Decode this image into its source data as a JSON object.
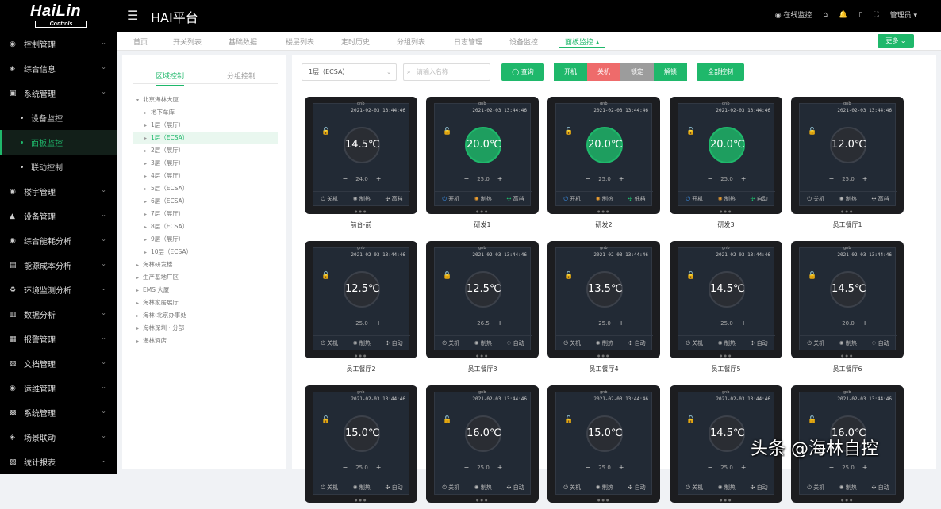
{
  "header": {
    "logo_word": "HaiLin",
    "logo_sub": "Controls",
    "menu_toggle": "☰",
    "title": "HAI平台",
    "right_items": [
      "◉ 在线监控",
      "⌂",
      "🔔",
      "▯",
      "⛶",
      "管理员 ▾"
    ]
  },
  "sidebar": {
    "items": [
      {
        "icon": "◉",
        "label": "控制管理"
      },
      {
        "icon": "◈",
        "label": "综合信息"
      },
      {
        "icon": "▣",
        "label": "系统管理"
      },
      {
        "icon": "◉",
        "label": "楼宇管理"
      },
      {
        "icon": "▲",
        "label": "设备管理"
      },
      {
        "icon": "◉",
        "label": "综合能耗分析"
      },
      {
        "icon": "▤",
        "label": "能源成本分析"
      },
      {
        "icon": "♻",
        "label": "环境监测分析"
      },
      {
        "icon": "▥",
        "label": "数据分析"
      },
      {
        "icon": "▦",
        "label": "报警管理"
      },
      {
        "icon": "▧",
        "label": "文档管理"
      },
      {
        "icon": "◉",
        "label": "运维管理"
      },
      {
        "icon": "▩",
        "label": "系统管理"
      },
      {
        "icon": "◈",
        "label": "场景联动"
      },
      {
        "icon": "▨",
        "label": "统计报表"
      }
    ],
    "subitems": [
      {
        "label": "设备监控"
      },
      {
        "label": "面板监控"
      },
      {
        "label": "联动控制"
      }
    ]
  },
  "tabs": [
    {
      "label": "首页"
    },
    {
      "label": "开关列表"
    },
    {
      "label": "基础数据"
    },
    {
      "label": "楼层列表"
    },
    {
      "label": "定时历史"
    },
    {
      "label": "分组列表"
    },
    {
      "label": "日志管理"
    },
    {
      "label": "设备监控"
    },
    {
      "label": "面板监控 ▴"
    }
  ],
  "back_button": "更多 ⌄",
  "tree": {
    "tabs": [
      "区域控制",
      "分组控制"
    ],
    "nodes": [
      {
        "label": "北京海林大厦",
        "level": 0,
        "open": true
      },
      {
        "label": "地下车库",
        "level": 1
      },
      {
        "label": "1层（展厅）",
        "level": 1
      },
      {
        "label": "1层（ECSA）",
        "level": 1,
        "selected": true
      },
      {
        "label": "2层（展厅）",
        "level": 1
      },
      {
        "label": "3层（展厅）",
        "level": 1
      },
      {
        "label": "4层（展厅）",
        "level": 1
      },
      {
        "label": "5层（ECSA）",
        "level": 1
      },
      {
        "label": "6层（ECSA）",
        "level": 1
      },
      {
        "label": "7层（展厅）",
        "level": 1
      },
      {
        "label": "8层（ECSA）",
        "level": 1
      },
      {
        "label": "9层（展厅）",
        "level": 1
      },
      {
        "label": "10层（ECSA）",
        "level": 1
      },
      {
        "label": "海林研发楼",
        "level": 0
      },
      {
        "label": "生产基地厂区",
        "level": 0
      },
      {
        "label": "EMS 大厦",
        "level": 0
      },
      {
        "label": "海林家居展厅",
        "level": 0
      },
      {
        "label": "海林·北京办事处",
        "level": 0
      },
      {
        "label": "海林深圳 · 分部",
        "level": 0
      },
      {
        "label": "海林酒店",
        "level": 0
      }
    ]
  },
  "toolbar": {
    "select_value": "1层（ECSA）",
    "search_placeholder": "请输入名称",
    "query": "◯ 查询",
    "on": "开机",
    "off": "关机",
    "lock": "锁定",
    "unlock": "解锁",
    "all": "全部控制"
  },
  "panels": [
    {
      "name": "前台-前",
      "time": "2021-02-03 13:44:46",
      "temp": "14.5℃",
      "set": "24.0",
      "on": false,
      "power": "关机",
      "mode": "制热",
      "fan": "高档"
    },
    {
      "name": "研发1",
      "time": "2021-02-03 13:44:46",
      "temp": "20.0℃",
      "set": "25.0",
      "on": true,
      "power": "开机",
      "mode": "制热",
      "fan": "高档"
    },
    {
      "name": "研发2",
      "time": "2021-02-03 13:44:46",
      "temp": "20.0℃",
      "set": "25.0",
      "on": true,
      "power": "开机",
      "mode": "制热",
      "fan": "低档"
    },
    {
      "name": "研发3",
      "time": "2021-02-03 13:44:46",
      "temp": "20.0℃",
      "set": "25.0",
      "on": true,
      "power": "开机",
      "mode": "制热",
      "fan": "自动"
    },
    {
      "name": "员工餐厅1",
      "time": "2021-02-03 13:44:46",
      "temp": "12.0℃",
      "set": "25.0",
      "on": false,
      "power": "关机",
      "mode": "制热",
      "fan": "高档"
    },
    {
      "name": "员工餐厅2",
      "time": "2021-02-03 13:44:46",
      "temp": "12.5℃",
      "set": "25.0",
      "on": false,
      "power": "关机",
      "mode": "制热",
      "fan": "自动"
    },
    {
      "name": "员工餐厅3",
      "time": "2021-02-03 13:44:46",
      "temp": "12.5℃",
      "set": "26.5",
      "on": false,
      "power": "关机",
      "mode": "制热",
      "fan": "自动"
    },
    {
      "name": "员工餐厅4",
      "time": "2021-02-03 13:44:46",
      "temp": "13.5℃",
      "set": "25.0",
      "on": false,
      "power": "关机",
      "mode": "制热",
      "fan": "自动"
    },
    {
      "name": "员工餐厅5",
      "time": "2021-02-03 13:44:46",
      "temp": "14.5℃",
      "set": "25.0",
      "on": false,
      "power": "关机",
      "mode": "制热",
      "fan": "自动"
    },
    {
      "name": "员工餐厅6",
      "time": "2021-02-03 13:44:46",
      "temp": "14.5℃",
      "set": "20.0",
      "on": false,
      "power": "关机",
      "mode": "制热",
      "fan": "自动"
    },
    {
      "name": "",
      "time": "2021-02-03 13:44:46",
      "temp": "15.0℃",
      "set": "25.0",
      "on": false,
      "power": "关机",
      "mode": "制热",
      "fan": "自动"
    },
    {
      "name": "",
      "time": "2021-02-03 13:44:46",
      "temp": "16.0℃",
      "set": "25.0",
      "on": false,
      "power": "关机",
      "mode": "制热",
      "fan": "自动"
    },
    {
      "name": "",
      "time": "2021-02-03 13:44:46",
      "temp": "15.0℃",
      "set": "25.0",
      "on": false,
      "power": "关机",
      "mode": "制热",
      "fan": "自动"
    },
    {
      "name": "",
      "time": "2021-02-03 13:44:46",
      "temp": "14.5℃",
      "set": "25.0",
      "on": false,
      "power": "关机",
      "mode": "制热",
      "fan": "自动"
    },
    {
      "name": "",
      "time": "2021-02-03 13:44:46",
      "temp": "16.0℃",
      "set": "25.0",
      "on": false,
      "power": "关机",
      "mode": "制热",
      "fan": "自动"
    }
  ],
  "panel_brand": "gnb",
  "watermark": "头条 @海林自控"
}
